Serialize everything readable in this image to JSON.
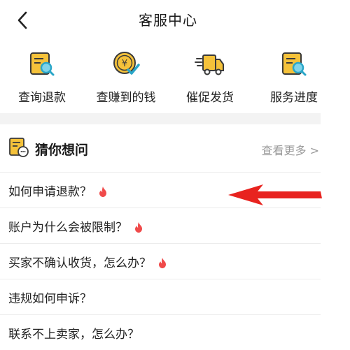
{
  "header": {
    "title": "客服中心",
    "back_icon": "chevron-left-icon"
  },
  "shortcuts": [
    {
      "label": "查询退款",
      "icon": "document-search-icon"
    },
    {
      "label": "查赚到的钱",
      "icon": "yuan-coin-check-icon"
    },
    {
      "label": "催促发货",
      "icon": "delivery-truck-icon"
    },
    {
      "label": "服务进度",
      "icon": "document-search-icon"
    }
  ],
  "faq": {
    "title": "猜你想问",
    "more_label": "查看更多 >",
    "items": [
      {
        "question": "如何申请退款？",
        "hot": true
      },
      {
        "question": "账户为什么会被限制？",
        "hot": true
      },
      {
        "question": "买家不确认收货，怎么办？",
        "hot": true
      },
      {
        "question": "违规如何申诉？",
        "hot": false
      },
      {
        "question": "联系不上卖家，怎么办？",
        "hot": false
      }
    ]
  },
  "colors": {
    "icon_yellow": "#f5c23a",
    "icon_dark": "#3a3a3a",
    "icon_teal": "#2aa6c8",
    "hot_red": "#f04a4a",
    "annotation_arrow": "#e8231f"
  }
}
